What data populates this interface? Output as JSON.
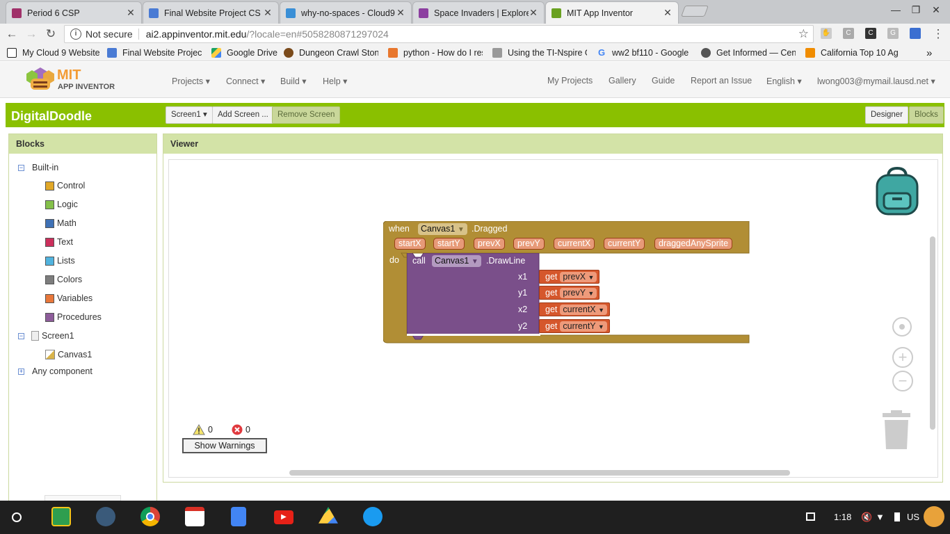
{
  "browser": {
    "tabs": [
      {
        "title": "Period 6 CSP",
        "favicon_color": "#a0316a",
        "active": false
      },
      {
        "title": "Final Website Project CS",
        "favicon_color": "#4a7bd4",
        "active": false
      },
      {
        "title": "why-no-spaces - Cloud9",
        "favicon_color": "#3a8fd6",
        "active": false
      },
      {
        "title": "Space Invaders | Explore",
        "favicon_color": "#8c3fa0",
        "active": false
      },
      {
        "title": "MIT App Inventor",
        "favicon_color": "#6aa121",
        "active": true
      }
    ],
    "url_security": "Not secure",
    "url_host": "ai2.appinventor.mit.edu",
    "url_path": "/?locale=en#5058280871297024",
    "bookmarks": [
      {
        "label": "My Cloud 9 Website",
        "icon_color": "#222222"
      },
      {
        "label": "Final Website Project",
        "icon_color": "#4a7bd4"
      },
      {
        "label": "Google Drive",
        "icon_color": "#1ea362"
      },
      {
        "label": "Dungeon Crawl Stone",
        "icon_color": "#7a4a1a"
      },
      {
        "label": "python - How do I res",
        "icon_color": "#e8772e"
      },
      {
        "label": "Using the TI-Nspire G",
        "icon_color": "#555555"
      },
      {
        "label": "ww2 bf110 - Google",
        "icon_color": "#4285f4"
      },
      {
        "label": "Get Informed — Cent",
        "icon_color": "#333333"
      },
      {
        "label": "California Top 10 Ag",
        "icon_color": "#f08c00"
      }
    ],
    "more_bookmarks": "»",
    "extensions": [
      "C",
      "C",
      "G"
    ]
  },
  "app": {
    "logo_text": "MIT",
    "logo_sub": "APP INVENTOR",
    "menus_left": [
      "Projects ▾",
      "Connect ▾",
      "Build ▾",
      "Help ▾"
    ],
    "menus_right": [
      "My Projects",
      "Gallery",
      "Guide",
      "Report an Issue",
      "English ▾",
      "lwong003@mymail.lausd.net ▾"
    ],
    "project_name": "DigitalDoodle",
    "screen_select": "Screen1 ▾",
    "add_screen": "Add Screen ...",
    "remove_screen": "Remove Screen",
    "designer_btn": "Designer",
    "blocks_btn": "Blocks"
  },
  "blocks_panel": {
    "title": "Blocks",
    "builtin_label": "Built-in",
    "builtin_items": [
      {
        "label": "Control",
        "color": "#e1a828"
      },
      {
        "label": "Logic",
        "color": "#84c04a"
      },
      {
        "label": "Math",
        "color": "#3f71b5"
      },
      {
        "label": "Text",
        "color": "#cc2f5c"
      },
      {
        "label": "Lists",
        "color": "#51b3de"
      },
      {
        "label": "Colors",
        "color": "#7d7d7d"
      },
      {
        "label": "Variables",
        "color": "#e8773a"
      },
      {
        "label": "Procedures",
        "color": "#8d5c9a"
      }
    ],
    "screen_label": "Screen1",
    "canvas_label": "Canvas1",
    "any_component": "Any component"
  },
  "viewer": {
    "title": "Viewer",
    "event_block": {
      "when": "when",
      "component": "Canvas1",
      "event": ".Dragged",
      "params": [
        "startX",
        "startY",
        "prevX",
        "prevY",
        "currentX",
        "currentY",
        "draggedAnySprite"
      ],
      "do": "do"
    },
    "call_block": {
      "call": "call",
      "component": "Canvas1",
      "method": ".DrawLine",
      "args": [
        {
          "name": "x1",
          "var": "prevX"
        },
        {
          "name": "y1",
          "var": "prevY"
        },
        {
          "name": "x2",
          "var": "currentX"
        },
        {
          "name": "y2",
          "var": "currentY"
        }
      ],
      "get": "get"
    },
    "warnings_count": "0",
    "errors_count": "0",
    "show_warnings": "Show Warnings"
  },
  "taskbar": {
    "time": "1:18",
    "lang": "US"
  },
  "colors": {
    "accent_green": "#8ac000",
    "event_block": "#b18e35",
    "procedure_block": "#7a4f8a",
    "variable_block": "#d5572c"
  }
}
